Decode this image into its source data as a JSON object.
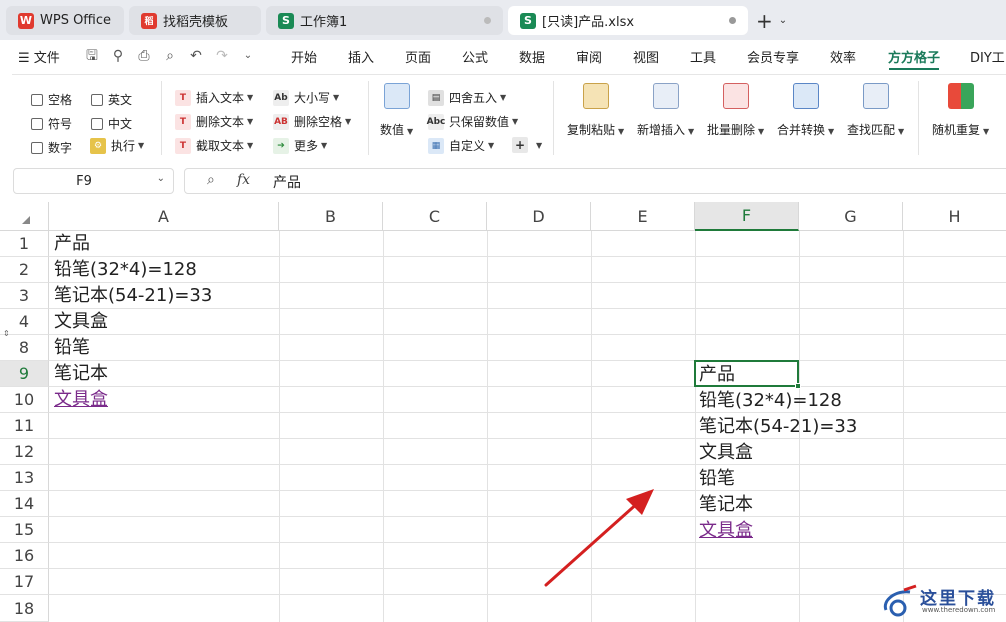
{
  "tabs": [
    {
      "label": "WPS Office",
      "logo": "W"
    },
    {
      "label": "找稻壳模板",
      "logo": "稻"
    },
    {
      "label": "工作簿1",
      "logo": "S"
    },
    {
      "label": "[只读]产品.xlsx",
      "logo": "S"
    }
  ],
  "menu": {
    "file": "文件",
    "items": [
      "开始",
      "插入",
      "页面",
      "公式",
      "数据",
      "审阅",
      "视图",
      "工具",
      "会员专享",
      "效率",
      "方方格子",
      "DIY工"
    ],
    "active": "方方格子"
  },
  "ribbon": {
    "checkboxes": [
      "空格",
      "英文",
      "符号",
      "中文",
      "数字"
    ],
    "exec": "执行",
    "text_ops": [
      "插入文本",
      "删除文本",
      "截取文本"
    ],
    "case_ops": [
      "大小写",
      "删除空格",
      "更多"
    ],
    "number": "数值",
    "round_ops": [
      "四舍五入",
      "只保留数值",
      "自定义"
    ],
    "big_buttons": [
      "复制粘贴",
      "新增插入",
      "批量删除",
      "合并转换",
      "查找匹配",
      "随机重复"
    ],
    "icon_labels": {
      "case": "Ab",
      "space": "AB",
      "keep_num": "Abc"
    }
  },
  "formula": {
    "name_box": "F9",
    "fx": "fx",
    "content": "产品"
  },
  "sheet": {
    "columns": [
      "A",
      "B",
      "C",
      "D",
      "E",
      "F",
      "G",
      "H"
    ],
    "selected_column": "F",
    "rows": [
      "1",
      "2",
      "3",
      "4",
      "8",
      "9",
      "10",
      "11",
      "12",
      "13",
      "14",
      "15",
      "16",
      "17",
      "18"
    ],
    "selected_row": "9",
    "col_a": [
      "产品",
      "铅笔(32*4)=128",
      "笔记本(54-21)=33",
      "文具盒",
      "铅笔",
      "笔记本",
      "文具盒"
    ],
    "col_f": [
      "产品",
      "铅笔(32*4)=128",
      "笔记本(54-21)=33",
      "文具盒",
      "铅笔",
      "笔记本",
      "文具盒"
    ]
  },
  "watermark": {
    "title": "这里下载",
    "url": "www.theredown.com"
  },
  "colors": {
    "accent": "#1a7a5a",
    "selection": "#1f7a3a",
    "link": "#7a2a8a",
    "arrow": "#d42020"
  }
}
